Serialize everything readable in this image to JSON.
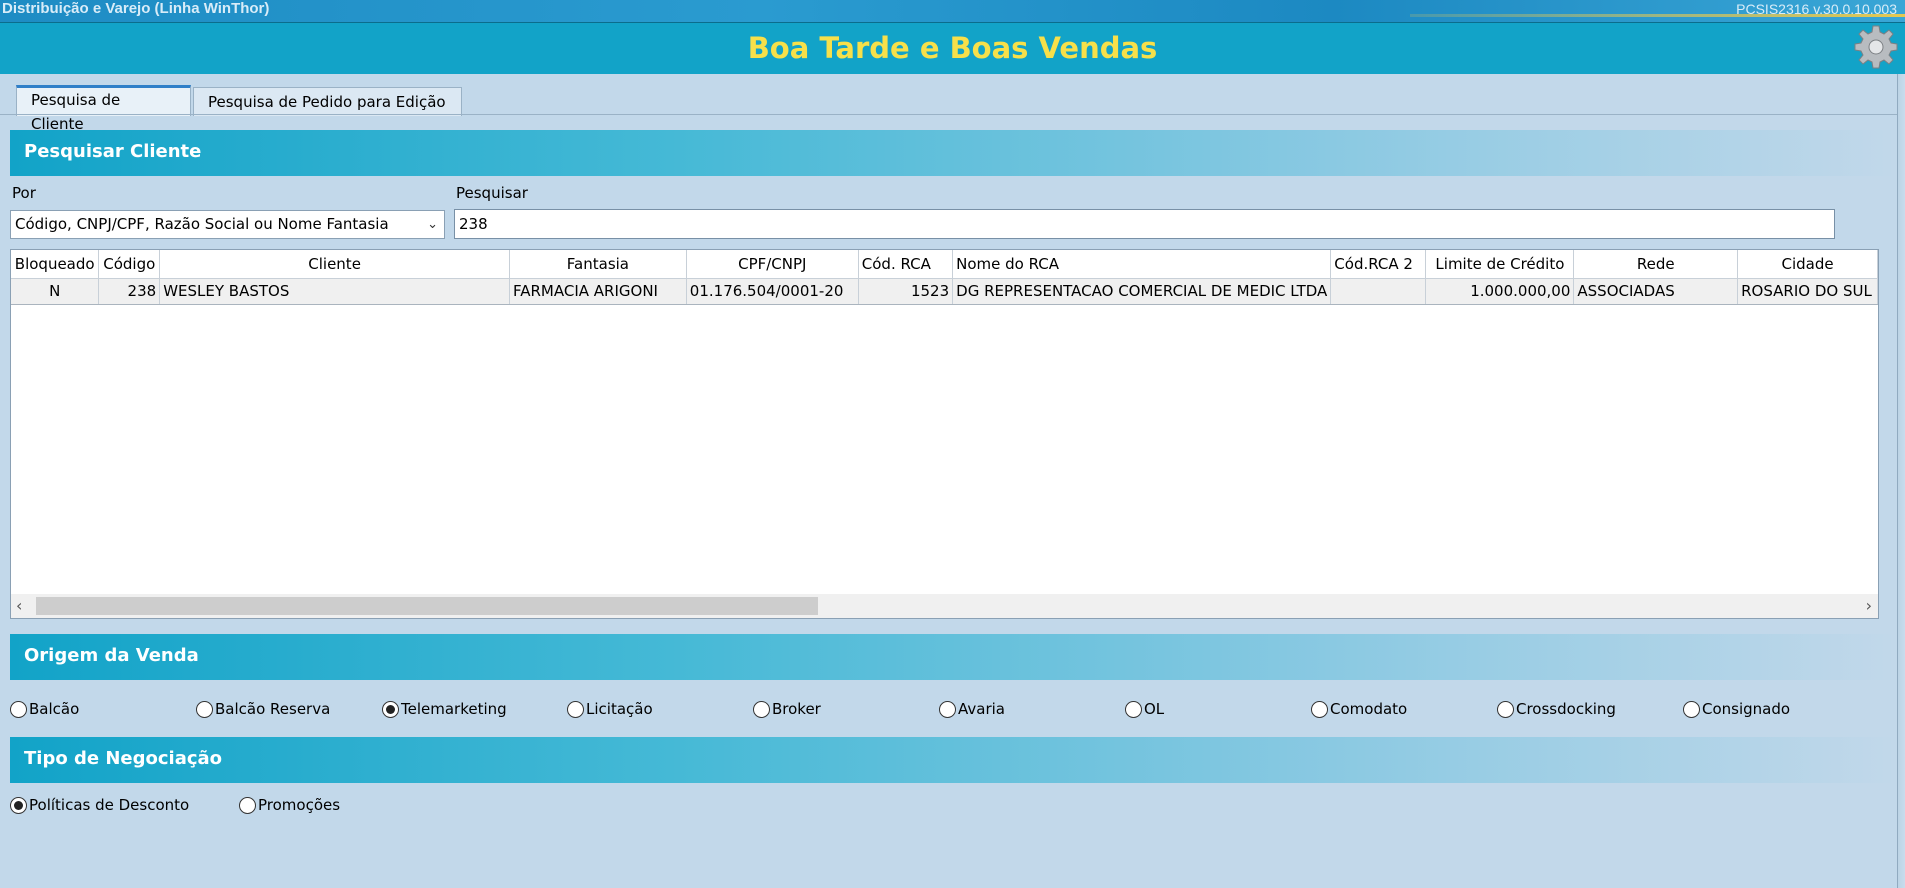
{
  "window": {
    "app_title": "Distribuição e Varejo (Linha WinThor)",
    "version": "PCSIS2316  v.30.0.10.003"
  },
  "header": {
    "welcome": "Boa Tarde e Boas Vendas",
    "settings_icon": "gear-icon"
  },
  "tabs": [
    {
      "label": "Pesquisa de Cliente",
      "active": true
    },
    {
      "label": "Pesquisa de Pedido para Edição",
      "active": false
    }
  ],
  "search": {
    "section_title": "Pesquisar Cliente",
    "por_label": "Por",
    "por_value": "Código, CNPJ/CPF, Razão Social ou Nome Fantasia",
    "pesquisar_label": "Pesquisar",
    "pesquisar_value": "238"
  },
  "grid": {
    "columns": [
      "Bloqueado",
      "Código",
      "Cliente",
      "Fantasia",
      "CPF/CNPJ",
      "Cód. RCA",
      "Nome do RCA",
      "Cód.RCA 2",
      "Limite de Crédito",
      "Rede",
      "Cidade"
    ],
    "rows": [
      {
        "bloqueado": "N",
        "codigo": "238",
        "cliente": "WESLEY BASTOS",
        "fantasia": "FARMACIA ARIGONI",
        "cpf_cnpj": "01.176.504/0001-20",
        "cod_rca": "1523",
        "nome_rca": "DG REPRESENTACAO COMERCIAL DE MEDIC LTDA",
        "cod_rca2": "",
        "limite_credito": "1.000.000,00",
        "rede": "ASSOCIADAS",
        "cidade": "ROSARIO DO SUL"
      }
    ]
  },
  "origem": {
    "section_title": "Origem da Venda",
    "options": [
      "Balcão",
      "Balcão Reserva",
      "Telemarketing",
      "Licitação",
      "Broker",
      "Avaria",
      "OL",
      "Comodato",
      "Crossdocking",
      "Consignado"
    ],
    "selected": "Telemarketing"
  },
  "negociacao": {
    "section_title": "Tipo de Negociação",
    "options": [
      "Políticas de Desconto",
      "Promoções"
    ],
    "selected": "Políticas de Desconto"
  }
}
